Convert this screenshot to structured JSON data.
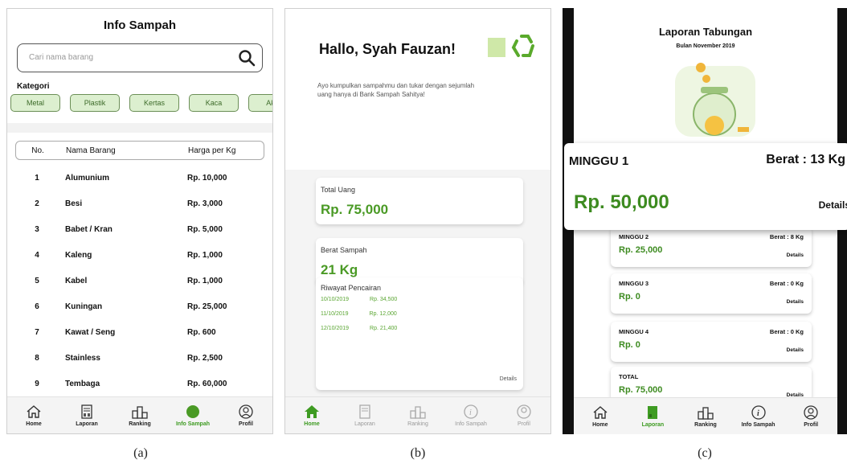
{
  "screen_a": {
    "title": "Info Sampah",
    "search_placeholder": "Cari nama barang",
    "kategori_label": "Kategori",
    "categories": [
      "Metal",
      "Plastik",
      "Kertas",
      "Kaca",
      "Akril"
    ],
    "table_headers": {
      "no": "No.",
      "nama": "Nama Barang",
      "harga": "Harga per Kg"
    },
    "rows": [
      {
        "no": "1",
        "nama": "Alumunium",
        "harga": "Rp. 10,000"
      },
      {
        "no": "2",
        "nama": "Besi",
        "harga": "Rp. 3,000"
      },
      {
        "no": "3",
        "nama": "Babet / Kran",
        "harga": "Rp. 5,000"
      },
      {
        "no": "4",
        "nama": "Kaleng",
        "harga": "Rp. 1,000"
      },
      {
        "no": "5",
        "nama": "Kabel",
        "harga": "Rp. 1,000"
      },
      {
        "no": "6",
        "nama": "Kuningan",
        "harga": "Rp. 25,000"
      },
      {
        "no": "7",
        "nama": "Kawat / Seng",
        "harga": "Rp. 600"
      },
      {
        "no": "8",
        "nama": "Stainless",
        "harga": "Rp. 2,500"
      },
      {
        "no": "9",
        "nama": "Tembaga",
        "harga": "Rp. 60,000"
      }
    ],
    "nav": [
      "Home",
      "Laporan",
      "Ranking",
      "Info Sampah",
      "Profil"
    ]
  },
  "screen_b": {
    "greeting": "Hallo, Syah Fauzan!",
    "description": "Ayo kumpulkan sampahmu dan tukar dengan sejumlah uang hanya di Bank Sampah Sahitya!",
    "total_uang_label": "Total Uang",
    "total_uang_value": "Rp. 75,000",
    "berat_label": "Berat Sampah",
    "berat_value": "21 Kg",
    "riwayat_label": "Riwayat Pencairan",
    "riwayat": [
      {
        "date": "10/10/2019",
        "amount": "Rp. 34,500"
      },
      {
        "date": "11/10/2019",
        "amount": "Rp. 12,000"
      },
      {
        "date": "12/10/2019",
        "amount": "Rp. 21,400"
      }
    ],
    "details_label": "Details",
    "nav": [
      "Home",
      "Laporan",
      "Ranking",
      "Info Sampah",
      "Profil"
    ]
  },
  "screen_c": {
    "title": "Laporan Tabungan",
    "subtitle": "Bulan November 2019",
    "highlight": {
      "week": "MINGGU 1",
      "berat": "Berat : 13 Kg",
      "amount": "Rp. 50,000",
      "details": "Details"
    },
    "weeks": [
      {
        "week": "MINGGU 2",
        "berat": "Berat : 8 Kg",
        "amount": "Rp. 25,000",
        "details": "Details"
      },
      {
        "week": "MINGGU 3",
        "berat": "Berat : 0 Kg",
        "amount": "Rp. 0",
        "details": "Details"
      },
      {
        "week": "MINGGU 4",
        "berat": "Berat : 0 Kg",
        "amount": "Rp. 0",
        "details": "Details"
      },
      {
        "week": "TOTAL",
        "berat": "",
        "amount": "Rp. 75,000",
        "details": "Details"
      }
    ],
    "nav": [
      "Home",
      "Laporan",
      "Ranking",
      "Info Sampah",
      "Profil"
    ]
  },
  "captions": [
    "(a)",
    "(b)",
    "(c)"
  ],
  "colors": {
    "accent_green": "#4a9a25",
    "chip_bg": "#dcefcf",
    "chip_border": "#6c8f57"
  }
}
